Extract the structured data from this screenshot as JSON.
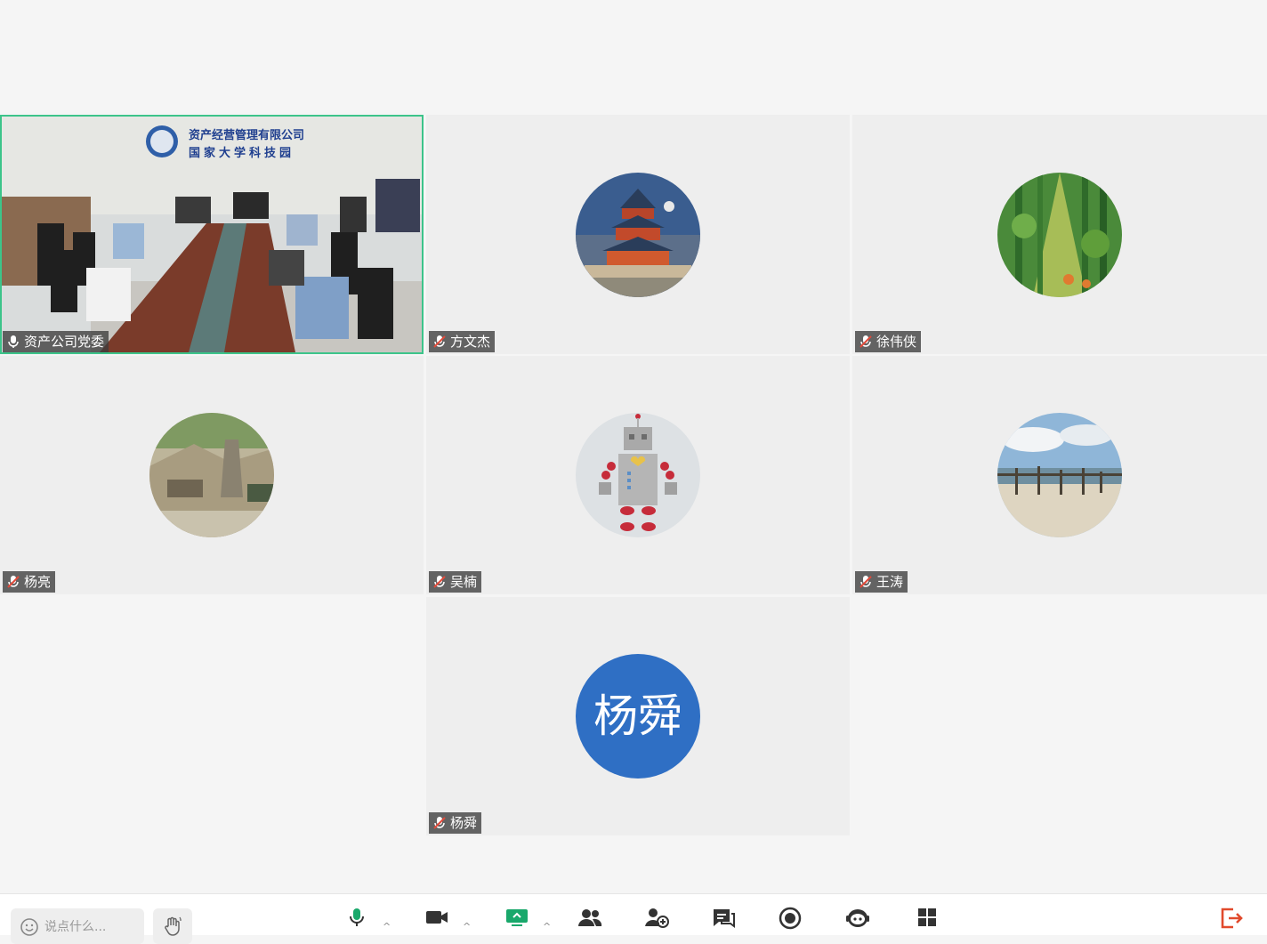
{
  "participants": [
    {
      "name": "资产公司党委",
      "mic": "on"
    },
    {
      "name": "方文杰",
      "mic": "muted"
    },
    {
      "name": "徐伟侠",
      "mic": "muted"
    },
    {
      "name": "杨亮",
      "mic": "muted"
    },
    {
      "name": "吴楠",
      "mic": "muted"
    },
    {
      "name": "王涛",
      "mic": "muted"
    },
    {
      "name": "杨舜",
      "mic": "muted",
      "avatar_text": "杨舜"
    }
  ],
  "video_sign": {
    "line1": "资产经营管理有限公司",
    "line2": "国家大学科技园"
  },
  "toolbar": {
    "chat_placeholder": "说点什么...",
    "icons": [
      "mic-icon",
      "camera-icon",
      "screen-share-icon",
      "participants-icon",
      "invite-icon",
      "chat-icon",
      "record-icon",
      "robot-icon",
      "layout-icon",
      "leave-icon"
    ]
  },
  "colors": {
    "active_border": "#3cc48a",
    "avatar_blue": "#2f6fc4",
    "leave_red": "#e14a2c",
    "screen_share_green": "#19a86b"
  }
}
